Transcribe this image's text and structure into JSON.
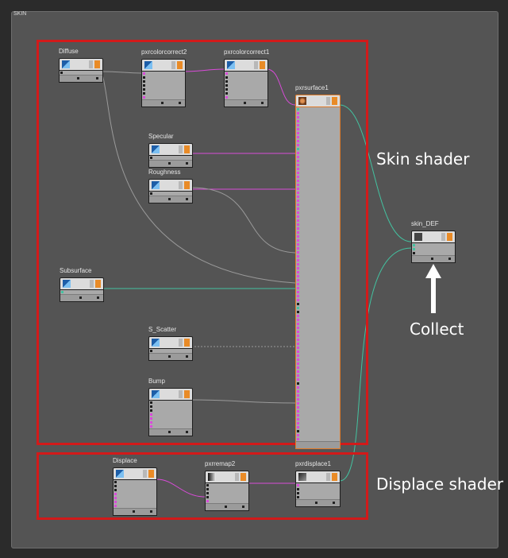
{
  "network_title": "SKIN",
  "annotations": {
    "skin_shader": "Skin shader",
    "collect": "Collect",
    "displace_shader": "Displace shader"
  },
  "colors": {
    "highlight_box": "#d21a1a",
    "wire_pink": "#d94bd9",
    "wire_green": "#43c2a0",
    "wire_gray": "#9a9a9a"
  },
  "nodes": {
    "diffuse": {
      "title": "Diffuse"
    },
    "pxrcolorcorrect2": {
      "title": "pxrcolorcorrect2"
    },
    "pxrcolorcorrect1": {
      "title": "pxrcolorcorrect1"
    },
    "pxrsurface1": {
      "title": "pxrsurface1"
    },
    "specular": {
      "title": "Specular"
    },
    "roughness": {
      "title": "Roughness"
    },
    "subsurface": {
      "title": "Subsurface"
    },
    "s_scatter": {
      "title": "S_Scatter"
    },
    "bump": {
      "title": "Bump"
    },
    "skin_def": {
      "title": "skin_DEF"
    },
    "displace": {
      "title": "Displace"
    },
    "pxrremap2": {
      "title": "pxrremap2"
    },
    "pxrdisplace1": {
      "title": "pxrdisplace1"
    }
  }
}
